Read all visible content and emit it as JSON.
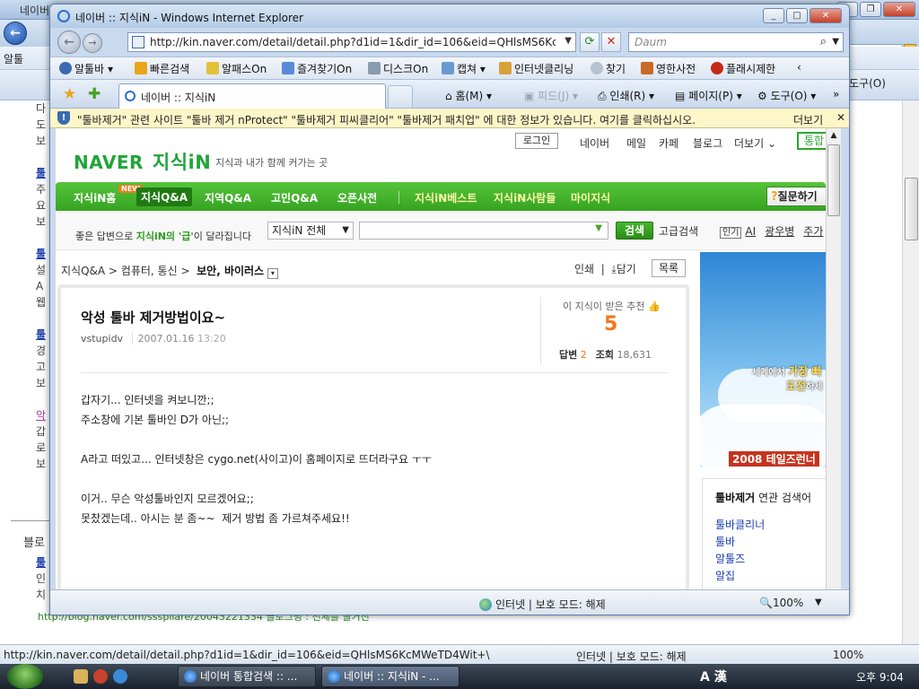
{
  "background_window": {
    "title": "네이버",
    "toolbar_label": "알툴",
    "tools_label": "도구(O)",
    "left_column_letters": [
      "다",
      "도",
      "보",
      "",
      "툴",
      "주",
      "요",
      "보",
      "",
      "툴",
      "설",
      "A",
      "웹",
      "",
      "툴",
      "경",
      "고",
      "보",
      "",
      "악",
      "갑",
      "로",
      "보"
    ],
    "blog_label": "블로",
    "blog_letters": [
      "툴",
      "인",
      "치"
    ],
    "blog_url": "http://blog.naver.com/ssspllare/20043221334 블로그명 : 전체를 끌거진",
    "status_url": "http://kin.naver.com/detail/detail.php?d1id=1&dir_id=106&eid=QHlsMS6KcMWeTD4Wit+\\",
    "status_zone": "인터넷 | 보호 모드: 해제",
    "status_zoom": "100%"
  },
  "taskbar": {
    "buttons": [
      "네이버 통합검색 :: ...",
      "네이버 :: 지식iN - ..."
    ],
    "ime": "A 漢",
    "clock": "오후 9:04"
  },
  "window": {
    "title": "네이버 :: 지식iN - Windows Internet Explorer",
    "address": "http://kin.naver.com/detail/detail.php?d1id=1&dir_id=106&eid=QHlsMS6KcMWeTD",
    "search_placeholder": "Daum",
    "toolbar_items": [
      "알툴바",
      "빠른검색",
      "알패스On",
      "즐겨찾기On",
      "디스크On",
      "캡쳐",
      "인터넷클리닝",
      "찾기",
      "영한사전",
      "플래시제한"
    ],
    "tab_label": "네이버 :: 지식iN",
    "commands": {
      "home": "홈(M)",
      "feeds": "피드(J)",
      "print": "인쇄(R)",
      "page": "페이지(P)",
      "tools": "도구(O)"
    },
    "infobar_message": "\"툴바제거\" 관련 사이트 \"툴바 제거 nProtect\" \"툴바제거 피씨클리어\" \"툴바제거 패치업\" 에 대한 정보가 있습니다. 여기를 클릭하십시오.",
    "infobar_more": "더보기",
    "status_zone": "인터넷 | 보호 모드: 해제",
    "status_zoom": "100%"
  },
  "naver": {
    "login": "로그인",
    "top_links": [
      "네이버",
      "메일",
      "카페",
      "블로그",
      "더보기"
    ],
    "top_search": "통합",
    "logo": "NAVER",
    "logo_service": "지식iN",
    "tagline": "지식과 내가 함께 커가는 곳",
    "new_badge": "NEW",
    "menu": [
      "지식iN홈",
      "지식Q&A",
      "지역Q&A",
      "고민Q&A",
      "오픈사전",
      "지식iN베스트",
      "지식iN사람들",
      "마이지식"
    ],
    "ask_button": "질문하기",
    "promo": "좋은 답변으로",
    "promo_em": "지식iN의 '급'",
    "promo_tail": "이 달라집니다",
    "search_scope": "지식iN 전체",
    "search_button": "검색",
    "advanced_search": "고급검색",
    "popular_badge": "인기",
    "popular_items": [
      "AI",
      "광우병",
      "주가"
    ],
    "breadcrumb": [
      "지식Q&A",
      "컴퓨터, 통신",
      "보안, 바이러스"
    ],
    "print": "인쇄",
    "save": "담기",
    "list": "목록",
    "question": {
      "title": "악성 툴바 제거방법이요~",
      "author": "vstupidv",
      "date": "2007.01.16",
      "time": "13:20",
      "recommend_label": "이 지식이 받은 추천",
      "recommend_count": "5",
      "answers_label": "답변",
      "answers_count": "2",
      "views_label": "조회",
      "views_count": "18,631",
      "body": "갑자기... 인터넷을 켜보니깐;;\n주소창에 기본 툴바인 D가 아닌;;\n\nA라고 떠있고... 인터넷창은 cygo.net(사이고)이 홈페이지로 뜨더라구요 ㅜㅜ\n\n이거.. 무슨 악성툴바인지 모르겠어요;;\n못찼겠는데.. 아시는 분 좀~~  제거 방법 좀 가르쳐주세요!!"
    },
    "banner": {
      "line1_a": "세계에서",
      "line1_b": "가장 빠",
      "line2_a": "도전",
      "line2_b": "하세",
      "footer": "2008 테일즈런너"
    },
    "related": {
      "title_bold": "툴바제거",
      "title_rest": "연관 검색어",
      "items": [
        "툴바클리너",
        "툴바",
        "알툴즈",
        "알집"
      ]
    }
  }
}
